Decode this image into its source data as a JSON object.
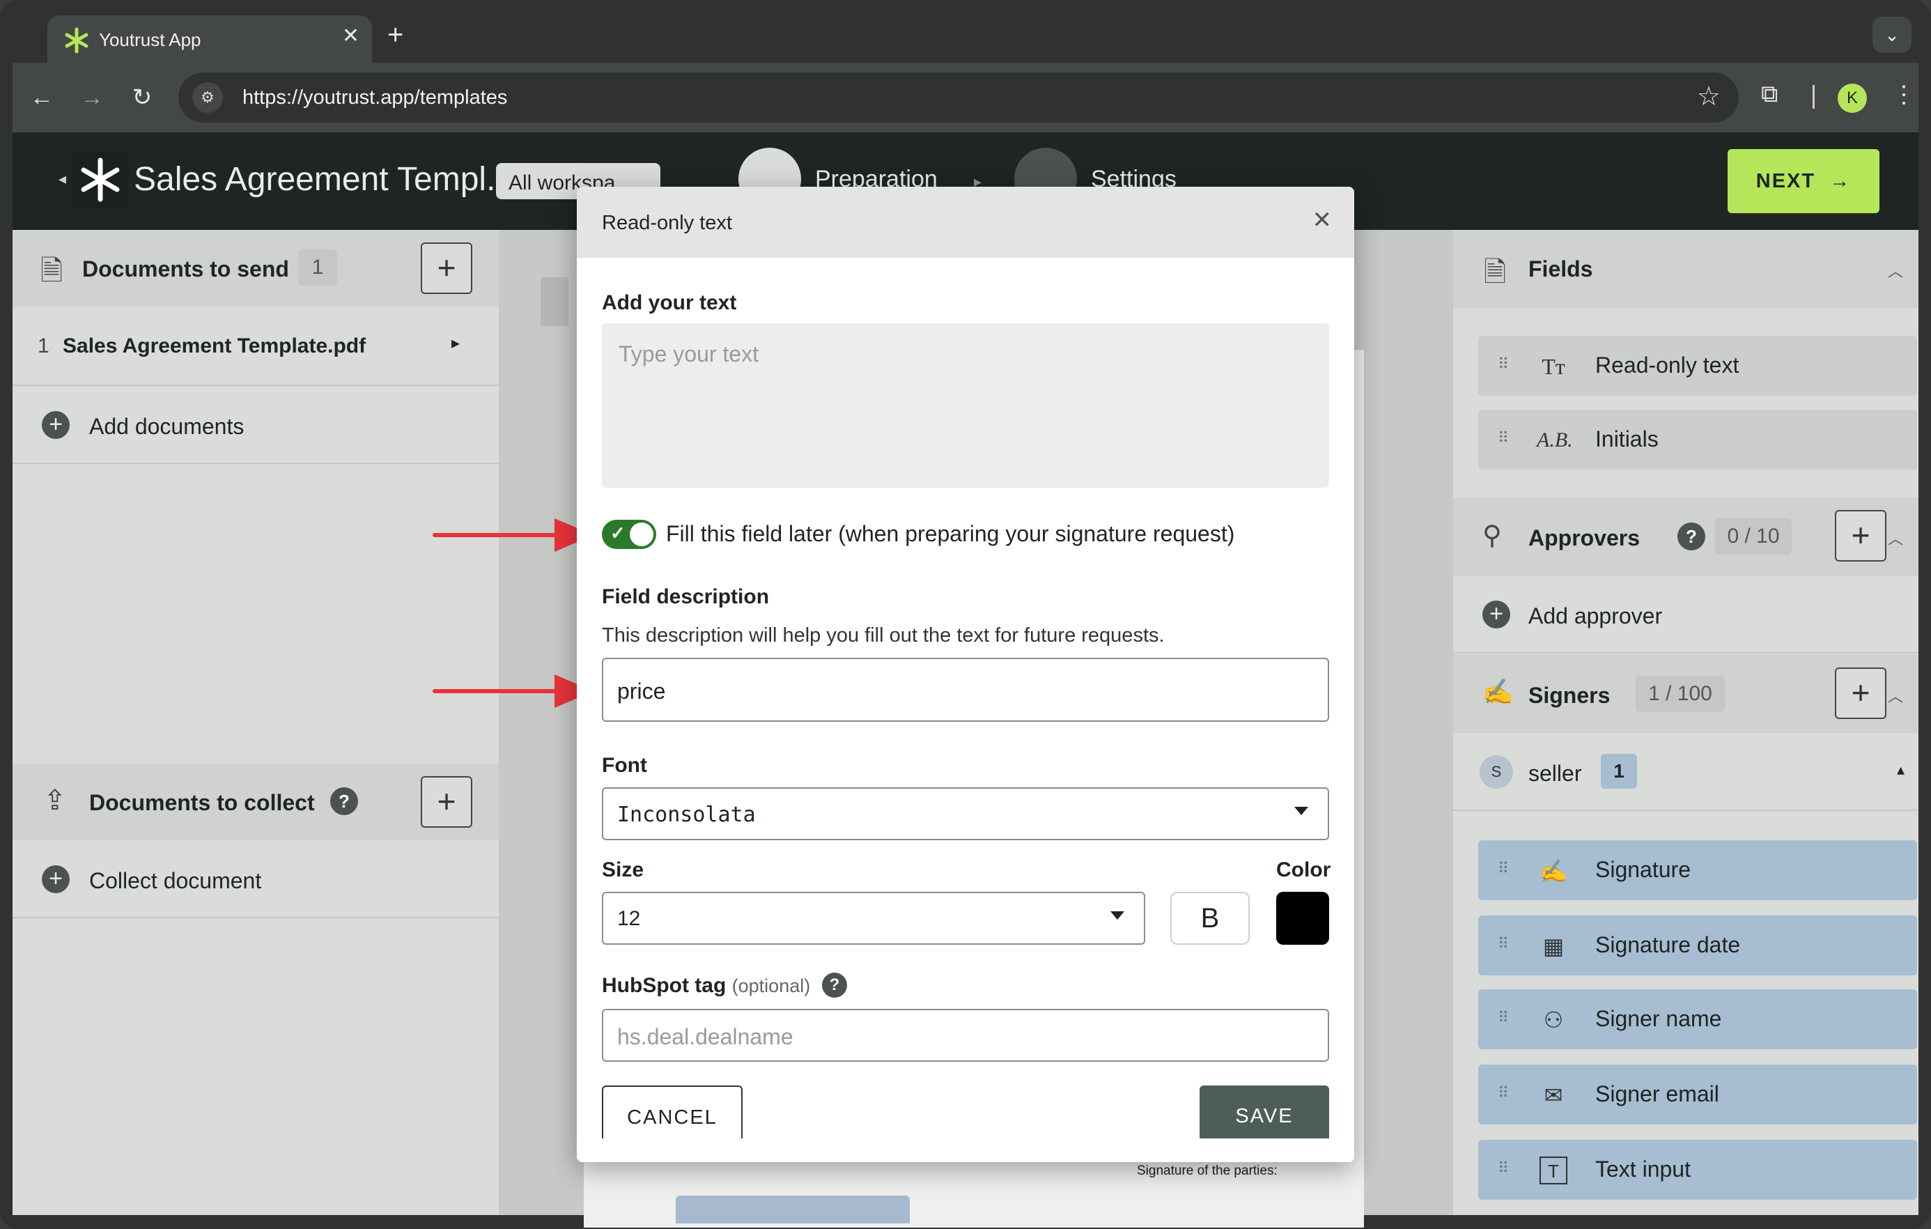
{
  "browser": {
    "tab_title": "Youtrust App",
    "tab_close": "✕",
    "new_tab": "+",
    "tab_menu": "⌄",
    "url": "https://youtrust.app/templates",
    "profile_initial": "K"
  },
  "header": {
    "doc_title": "Sales Agreement Templ...",
    "workspace": "All workspa",
    "steps": [
      {
        "label": "Preparation"
      },
      {
        "label": "Settings"
      }
    ],
    "next_label": "NEXT",
    "accent": "#b5e65a"
  },
  "left": {
    "send_title": "Documents to send",
    "send_count": "1",
    "doc_index": "1",
    "doc_name": "Sales Agreement Template.pdf",
    "add_documents": "Add documents",
    "collect_title": "Documents to collect",
    "collect_document": "Collect document"
  },
  "canvas": {
    "signature_of_parties": "Signature of the parties:"
  },
  "right": {
    "fields_title": "Fields",
    "field_items": [
      {
        "label": "Read-only text",
        "icon": "text-icon"
      },
      {
        "label": "Initials",
        "icon": "initials-icon"
      }
    ],
    "approvers_title": "Approvers",
    "approvers_count": "0 / 10",
    "add_approver": "Add approver",
    "signers_title": "Signers",
    "signers_count": "1 / 100",
    "signer_initial": "S",
    "signer_name": "seller",
    "signer_badge": "1",
    "signer_fields": [
      {
        "label": "Signature",
        "icon": "signature-icon"
      },
      {
        "label": "Signature date",
        "icon": "calendar-icon"
      },
      {
        "label": "Signer name",
        "icon": "person-icon"
      },
      {
        "label": "Signer email",
        "icon": "envelope-icon"
      },
      {
        "label": "Text input",
        "icon": "text-input-icon"
      }
    ]
  },
  "modal": {
    "title": "Read-only text",
    "add_text_label": "Add your text",
    "text_placeholder": "Type your text",
    "toggle_on": true,
    "toggle_label": "Fill this field later (when preparing your signature request)",
    "field_desc_label": "Field description",
    "field_desc_help": "This description will help you fill out the text for future requests.",
    "field_desc_value": "price",
    "font_label": "Font",
    "font_value": "Inconsolata",
    "size_label": "Size",
    "size_value": "12",
    "bold_label": "B",
    "color_label": "Color",
    "color_value": "#000000",
    "hubspot_label": "HubSpot tag",
    "hubspot_optional": "(optional)",
    "hubspot_placeholder": "hs.deal.dealname",
    "cancel_label": "CANCEL",
    "save_label": "SAVE"
  },
  "annotation_color": "#e8333a"
}
